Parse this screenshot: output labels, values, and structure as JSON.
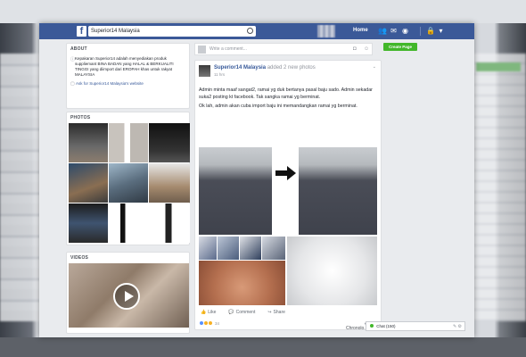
{
  "topbar": {
    "logo": "f",
    "search_value": "Superior14 Malaysia",
    "home": "Home",
    "icon_friends": "friends-icon",
    "icon_messages": "messages-icon",
    "icon_notifications": "globe-icon",
    "icon_settings": "settings-icon"
  },
  "about": {
    "title": "ABOUT",
    "description": "Kepakaran Superior14 adalah menyediakan produk suppliemant BINA BADAN yang HALAL & BERKUALITI TINGGI yang diimport dari EROPAH khas untuk rakyat MALAYSIA",
    "link": "Ask for Superior14 Malaysia's website"
  },
  "photos": {
    "title": "PHOTOS"
  },
  "videos": {
    "title": "VIDEOS"
  },
  "compose": {
    "placeholder": "Write a comment..."
  },
  "post": {
    "page_name": "Superior14 Malaysia",
    "added": "added 2 new photos",
    "time": "11 hrs",
    "paragraph1": "Admin minta maaf sangat2, ramai yg duk bertanya pasal baju sado. Admin sekadar suka2 posting kt facebook. Tak sangka ramai yg berminat.",
    "paragraph2": "Ok lah, admin akan cuba import baju ini memandangkan ramai yg berminat.",
    "like": "Like",
    "comment": "Comment",
    "share": "Share",
    "reaction_count": "34",
    "chronological": "Chronolo..."
  },
  "right": {
    "create_page": "Create Page"
  },
  "chat": {
    "label": "Chat (150)"
  }
}
